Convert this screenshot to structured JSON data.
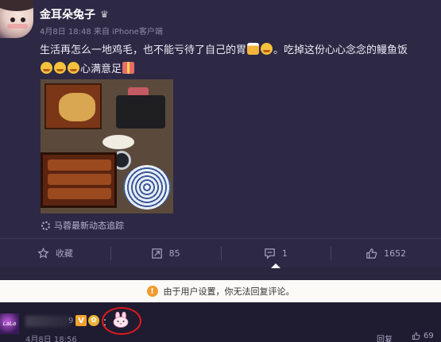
{
  "post": {
    "username": "金耳朵兔子",
    "crown_icon": "crown-icon",
    "meta": "4月8日 18:48 来自 iPhone客户端",
    "text_part1": "生活再怎么一地鸡毛，也不能亏待了自己的胃",
    "text_part2": "。吃掉这份心心念念的鳗鱼饭",
    "text_part3": "心满意足",
    "image_alt": "unagi and tempura meal photo",
    "source_label": "马蓉最新动态追踪"
  },
  "actions": {
    "favorite_label": "收藏",
    "repost_count": "85",
    "comment_count": "1",
    "like_count": "1652"
  },
  "notice": {
    "icon": "!",
    "text": "由于用户设置，你无法回复评论。"
  },
  "comment": {
    "avatar_text": "LaLa",
    "name_tail": "9",
    "vip_badge": "V",
    "colon": "：",
    "meta": "4月8日 18:56",
    "reply_label": "回复",
    "like_count": "69"
  },
  "colors": {
    "background": "#2a2640",
    "card": "#2d2944",
    "notice_bg": "#fbfaf7",
    "notice_icon": "#f29b2e",
    "highlight_circle": "#e0191d"
  }
}
